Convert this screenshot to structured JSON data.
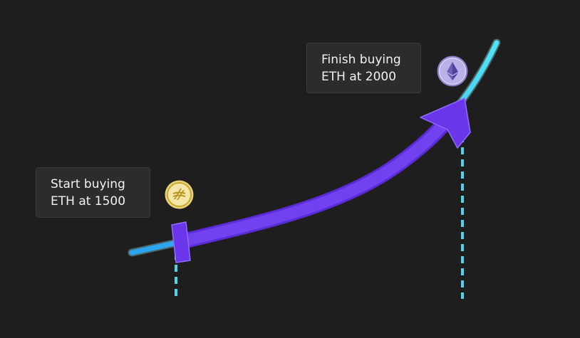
{
  "diagram": {
    "start": {
      "line1": "Start buying",
      "line2": "ETH at 1500",
      "icon": "gold-coin-icon"
    },
    "finish": {
      "line1": "Finish buying",
      "line2": "ETH at 2000",
      "icon": "ethereum-icon"
    },
    "colors": {
      "background": "#1e1e1e",
      "curve": "#3ec6f5",
      "arrow": "#6b35ea",
      "dashed_marker": "#4fd6e6",
      "callout_bg": "#2c2c2c",
      "gold": "#e0c24a",
      "eth_purple": "#9a8fd8"
    }
  }
}
